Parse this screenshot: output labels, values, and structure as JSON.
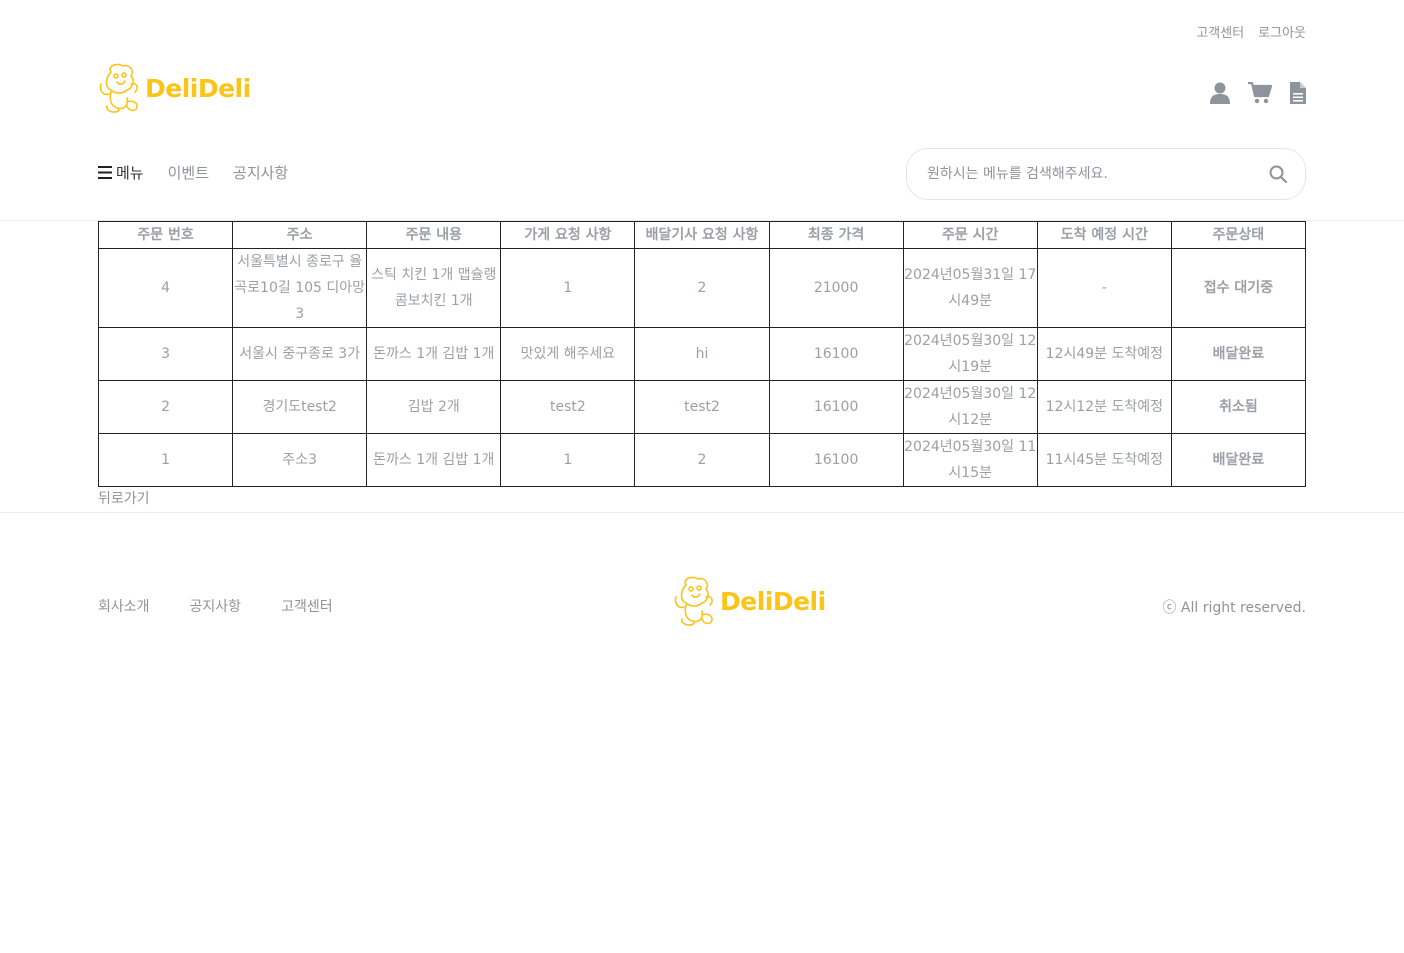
{
  "top_links": {
    "support": "고객센터",
    "logout": "로그아웃"
  },
  "brand": {
    "name": "DeliDeli",
    "color": "#fcc419"
  },
  "header_icons": [
    "user-icon",
    "cart-icon",
    "document-icon"
  ],
  "nav": {
    "menu": "메뉴",
    "event": "이벤트",
    "notice": "공지사항"
  },
  "search": {
    "placeholder": "원하시는 메뉴를 검색해주세요.",
    "value": ""
  },
  "orders": {
    "headers": [
      "주문 번호",
      "주소",
      "주문 내용",
      "가게 요청 사항",
      "배달기사 요청 사항",
      "최종 가격",
      "주문 시간",
      "도착 예정 시간",
      "주문상태"
    ],
    "rows": [
      [
        "4",
        "서울특별시 종로구 율곡로10길 105 디아망 3",
        "스틱 치킨 1개 맵슐랭 콤보치킨 1개",
        "1",
        "2",
        "21000",
        "2024년05월31일 17시49분",
        "-",
        "접수 대기중"
      ],
      [
        "3",
        "서울시 중구종로 3가",
        "돈까스 1개 김밥 1개",
        "맛있게 해주세요",
        "hi",
        "16100",
        "2024년05월30일 12시19분",
        "12시49분 도착예정",
        "배달완료"
      ],
      [
        "2",
        "경기도test2",
        "김밥 2개",
        "test2",
        "test2",
        "16100",
        "2024년05월30일 12시12분",
        "12시12분 도착예정",
        "취소됨"
      ],
      [
        "1",
        "주소3",
        "돈까스 1개 김밥 1개",
        "1",
        "2",
        "16100",
        "2024년05월30일 11시15분",
        "11시45분 도착예정",
        "배달완료"
      ]
    ]
  },
  "back_label": "뒤로가기",
  "footer": {
    "links": [
      "회사소개",
      "공지사항",
      "고객센터"
    ],
    "copyright": "ⓒ All right reserved."
  }
}
